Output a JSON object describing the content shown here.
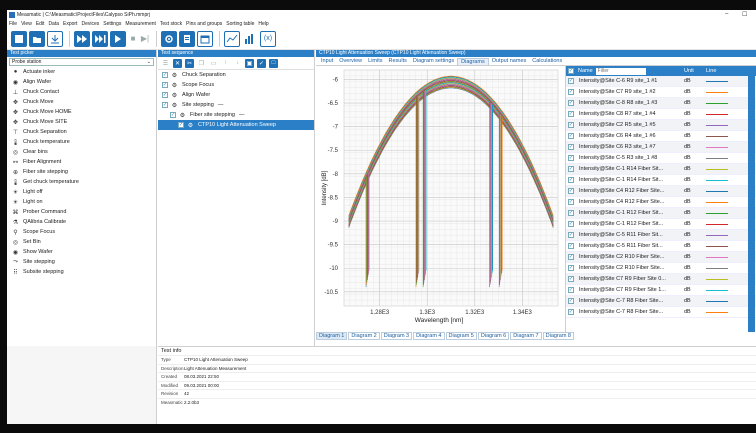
{
  "window": {
    "title": "Measmatic | C:\\Measmatic\\ProjectFiles\\Calypso SiPh.mmprj",
    "minimize": "–",
    "maximize": "☐"
  },
  "menu": [
    "File",
    "View",
    "Edit",
    "Data",
    "Export",
    "Devices",
    "Settings",
    "Measurement",
    "Test stock",
    "Pins and groups",
    "Sorting table",
    "Help"
  ],
  "left_panel": {
    "title": "Test picker",
    "selector_value": "Probe station",
    "items": [
      {
        "label": "Actuate inker",
        "icon": "inker-icon"
      },
      {
        "label": "Align Wafer",
        "icon": "wafer-icon"
      },
      {
        "label": "Chuck Contact",
        "icon": "chuck-contact-icon"
      },
      {
        "label": "Chuck Move",
        "icon": "move-icon"
      },
      {
        "label": "Chuck Move HOME",
        "icon": "move-icon"
      },
      {
        "label": "Chuck Move SITE",
        "icon": "move-icon"
      },
      {
        "label": "Chuck Separation",
        "icon": "chuck-separation-icon"
      },
      {
        "label": "Chuck temperature",
        "icon": "thermometer-icon"
      },
      {
        "label": "Clear bins",
        "icon": "bin-icon"
      },
      {
        "label": "Fiber Alignment",
        "icon": "fiber-icon"
      },
      {
        "label": "Fiber site stepping",
        "icon": "fiber-step-icon"
      },
      {
        "label": "Get chuck temperature",
        "icon": "thermometer-icon"
      },
      {
        "label": "Light off",
        "icon": "bulb-icon"
      },
      {
        "label": "Light on",
        "icon": "bulb-icon"
      },
      {
        "label": "Prober Command",
        "icon": "command-icon"
      },
      {
        "label": "QAlibria Calibrate",
        "icon": "calibrate-icon"
      },
      {
        "label": "Scope Focus",
        "icon": "search-icon"
      },
      {
        "label": "Set Bin",
        "icon": "bin-icon"
      },
      {
        "label": "Show Wafer",
        "icon": "wafer-icon"
      },
      {
        "label": "Site stepping",
        "icon": "step-icon"
      },
      {
        "label": "Subsite stepping",
        "icon": "subsite-icon"
      }
    ]
  },
  "sequence_panel": {
    "title": "Test sequence",
    "items": [
      {
        "label": "Chuck Separation",
        "indent": 0,
        "suffix": ""
      },
      {
        "label": "Scope Focus",
        "indent": 0,
        "suffix": ""
      },
      {
        "label": "Align Wafer",
        "indent": 0,
        "suffix": ""
      },
      {
        "label": "Site stepping",
        "indent": 0,
        "suffix": "—"
      },
      {
        "label": "Fiber site stepping",
        "indent": 1,
        "suffix": "—"
      },
      {
        "label": "CTP10 Light Attenuation Sweep",
        "indent": 2,
        "suffix": "",
        "selected": true
      }
    ]
  },
  "right_panel": {
    "title": "CTP10 Light Attenuation Sweep (CTP10 Light Attenuation Sweep)",
    "tabs": [
      "Input",
      "Overview",
      "Limits",
      "Results",
      "Diagram settings",
      "Diagrams",
      "Output names",
      "Calculations"
    ],
    "active_tab": "Diagrams",
    "bottom_tabs": [
      "Diagram 1",
      "Diagram 2",
      "Diagram 3",
      "Diagram 4",
      "Diagram 5",
      "Diagram 6",
      "Diagram 7",
      "Diagram 8"
    ],
    "table": {
      "col_name": "Name",
      "filter_placeholder": "Filter",
      "col_unit": "Unit",
      "col_line": "Line",
      "rows": [
        {
          "name": "Intensity@Site C-6 R9 site_1 #1",
          "unit": "dB",
          "color": "#1f77b4"
        },
        {
          "name": "Intensity@Site C7 R9 site_1 #2",
          "unit": "dB",
          "color": "#ff7f0e"
        },
        {
          "name": "Intensity@Site C-8 R8 site_1 #3",
          "unit": "dB",
          "color": "#2ca02c"
        },
        {
          "name": "Intensity@Site C8 R7 site_1 #4",
          "unit": "dB",
          "color": "#d62728"
        },
        {
          "name": "Intensity@Site C2 R5 site_1 #5",
          "unit": "dB",
          "color": "#9467bd"
        },
        {
          "name": "Intensity@Site C6 R4 site_1 #6",
          "unit": "dB",
          "color": "#8c564b"
        },
        {
          "name": "Intensity@Site C6 R3 site_1 #7",
          "unit": "dB",
          "color": "#e377c2"
        },
        {
          "name": "Intensity@Site C-5 R3 site_1 #8",
          "unit": "dB",
          "color": "#7f7f7f"
        },
        {
          "name": "Intensity@Site C-1 R14 Fiber Sit...",
          "unit": "dB",
          "color": "#bcbd22"
        },
        {
          "name": "Intensity@Site C-1 R14 Fiber Sit...",
          "unit": "dB",
          "color": "#17becf"
        },
        {
          "name": "Intensity@Site C4 R12 Fiber Site...",
          "unit": "dB",
          "color": "#1f77b4"
        },
        {
          "name": "Intensity@Site C4 R12 Fiber Site...",
          "unit": "dB",
          "color": "#ff7f0e"
        },
        {
          "name": "Intensity@Site C-1 R12 Fiber Sit...",
          "unit": "dB",
          "color": "#2ca02c"
        },
        {
          "name": "Intensity@Site C-1 R12 Fiber Sit...",
          "unit": "dB",
          "color": "#d62728"
        },
        {
          "name": "Intensity@Site C-5 R11 Fiber Sit...",
          "unit": "dB",
          "color": "#9467bd"
        },
        {
          "name": "Intensity@Site C-5 R11 Fiber Sit...",
          "unit": "dB",
          "color": "#8c564b"
        },
        {
          "name": "Intensity@Site C2 R10 Fiber Site...",
          "unit": "dB",
          "color": "#e377c2"
        },
        {
          "name": "Intensity@Site C2 R10 Fiber Site...",
          "unit": "dB",
          "color": "#7f7f7f"
        },
        {
          "name": "Intensity@Site C7 R9 Fiber Site 0...",
          "unit": "dB",
          "color": "#bcbd22"
        },
        {
          "name": "Intensity@Site C7 R9 Fiber Site 1...",
          "unit": "dB",
          "color": "#17becf"
        },
        {
          "name": "Intensity@Site C-7 R8 Fiber Site...",
          "unit": "dB",
          "color": "#1f77b4"
        },
        {
          "name": "Intensity@Site C-7 R8 Fiber Site...",
          "unit": "dB",
          "color": "#ff7f0e"
        }
      ]
    }
  },
  "test_info": {
    "title": "Test info",
    "rows": [
      {
        "key": "Type",
        "value": "CTP10 Light Attenuation Sweep"
      },
      {
        "key": "Description",
        "value": "Light Attenuation Measurement"
      },
      {
        "key": "Created",
        "value": "08.03.2021 22:50"
      },
      {
        "key": "Modified",
        "value": "09.03.2021 00:00"
      },
      {
        "key": "Revision",
        "value": "42"
      },
      {
        "key": "Measmatic",
        "value": "2.2.0b3"
      }
    ]
  },
  "chart_data": {
    "type": "line",
    "title": "",
    "xlabel": "Wavelength [nm]",
    "ylabel": "Intensity [dB]",
    "xlim": [
      1265,
      1355
    ],
    "ylim": [
      -10.8,
      -5.8
    ],
    "x_ticks": [
      "1.28E3",
      "1.3E3",
      "1.32E3",
      "1.34E3"
    ],
    "x_tick_values": [
      1280,
      1300,
      1320,
      1340
    ],
    "y_ticks": [
      -6,
      -6.5,
      -7,
      -7.5,
      -8,
      -8.5,
      -9,
      -9.5,
      -10,
      -10.5
    ],
    "grid": true,
    "series_count": 22,
    "curve": {
      "peak_x": 1310,
      "peak_y": -6.05,
      "curvature": 0.0016,
      "x_start": 1267,
      "x_end": 1353
    },
    "dropouts_x": [
      1275,
      1296,
      1299,
      1327,
      1331
    ],
    "dropout_bottom": -10.4,
    "palette": [
      "#1f77b4",
      "#ff7f0e",
      "#2ca02c",
      "#d62728",
      "#9467bd",
      "#8c564b",
      "#e377c2",
      "#7f7f7f",
      "#bcbd22",
      "#17becf"
    ]
  }
}
